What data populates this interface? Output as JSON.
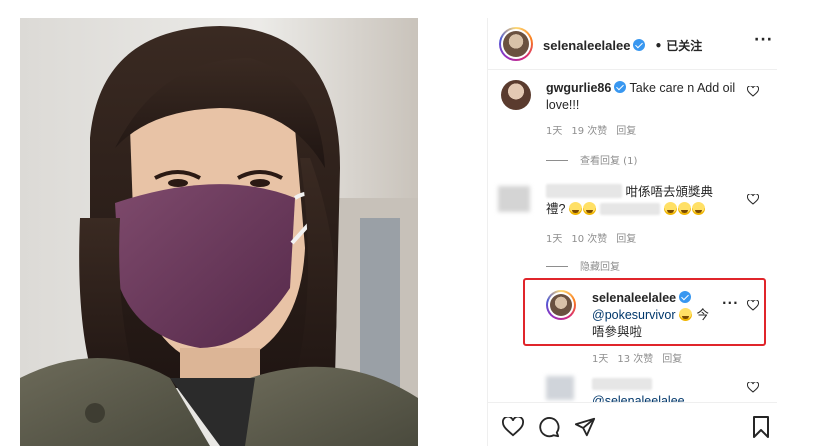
{
  "post": {
    "username": "selenaleelalee",
    "separator": "•",
    "follow_status": "已关注",
    "more_icon": "more-horizontal-icon"
  },
  "comments": [
    {
      "username": "gwgurlie86",
      "text_line1": "Take care n Add oil",
      "text_line2": "love!!!",
      "time": "1天",
      "likes": "19 次赞",
      "reply": "回复",
      "thread_toggle": "查看回复 (1)"
    },
    {
      "username": "",
      "text_line1": "咁係唔去頒獎典",
      "text_line2": "禮?",
      "time": "1天",
      "likes": "10 次赞",
      "reply": "回复",
      "thread_toggle": "隐藏回复"
    }
  ],
  "reply": {
    "username": "selenaleelalee",
    "mention": "@pokesurvivor",
    "text_suffix": "今",
    "text_line2": "唔參與啦",
    "time": "1天",
    "likes": "13 次赞",
    "reply": "回复"
  },
  "next_reply": {
    "mention": "@selenaleelalee"
  },
  "colors": {
    "verified": "#3897f0",
    "highlight_border": "#e0252b",
    "meta_text": "#8e8e8e",
    "mask": "#6e3a5e"
  },
  "icons": [
    "heart-icon",
    "comment-icon",
    "share-icon",
    "bookmark-icon",
    "verified-badge-icon"
  ]
}
